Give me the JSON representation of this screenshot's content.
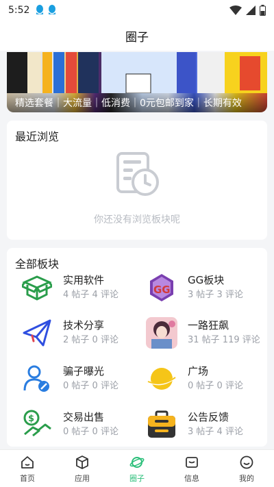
{
  "status_bar": {
    "time": "5:52"
  },
  "header": {
    "title": "圈子"
  },
  "banner": {
    "caption": "精选套餐｜大流量｜低消费｜0元包邮到家｜长期有效"
  },
  "recent": {
    "title": "最近浏览",
    "empty_text": "你还没有浏览板块呢"
  },
  "all_boards": {
    "title": "全部板块",
    "items": [
      {
        "name": "实用软件",
        "stats": "4 帖子 4 评论",
        "icon": "box-icon"
      },
      {
        "name": "GG板块",
        "stats": "3 帖子 3 评论",
        "icon": "gg-logo-icon"
      },
      {
        "name": "技术分享",
        "stats": "2 帖子 0 评论",
        "icon": "paper-plane-icon"
      },
      {
        "name": "一路狂飙",
        "stats": "31 帖子 119 评论",
        "icon": "anime-avatar-icon"
      },
      {
        "name": "骗子曝光",
        "stats": "0 帖子 0 评论",
        "icon": "user-block-icon"
      },
      {
        "name": "广场",
        "stats": "0 帖子 0 评论",
        "icon": "planet-icon"
      },
      {
        "name": "交易出售",
        "stats": "0 帖子 0 评论",
        "icon": "money-handshake-icon"
      },
      {
        "name": "公告反馈",
        "stats": "3 帖子 4 评论",
        "icon": "briefcase-icon"
      }
    ]
  },
  "tabs": [
    {
      "label": "首页",
      "icon": "home-icon"
    },
    {
      "label": "应用",
      "icon": "cube-icon"
    },
    {
      "label": "圈子",
      "icon": "planet-icon",
      "active": true
    },
    {
      "label": "信息",
      "icon": "message-icon"
    },
    {
      "label": "我的",
      "icon": "smile-icon"
    }
  ],
  "colors": {
    "accent": "#2bbf7a",
    "background": "#f4f5f7",
    "muted": "#9a9ea6"
  }
}
